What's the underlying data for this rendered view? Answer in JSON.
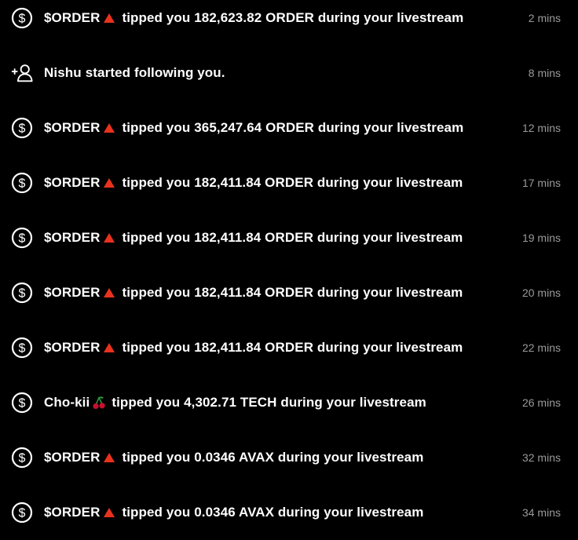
{
  "colors": {
    "background": "#000000",
    "text": "#ffffff",
    "timestamp": "#9a9a9a",
    "triangle_red": "#e8321e",
    "cherry_red": "#c8102e",
    "cherry_leaf": "#2e9e3a"
  },
  "notifications": [
    {
      "icon": "dollar-circle-icon",
      "user": "$ORDER",
      "emoji": "red-triangle-icon",
      "message": "tipped you 182,623.82 ORDER during your livestream",
      "time": "2 mins"
    },
    {
      "icon": "user-plus-icon",
      "user": "Nishu",
      "emoji": "",
      "message": "started following you.",
      "time": "8 mins"
    },
    {
      "icon": "dollar-circle-icon",
      "user": "$ORDER",
      "emoji": "red-triangle-icon",
      "message": "tipped you 365,247.64 ORDER during your livestream",
      "time": "12 mins"
    },
    {
      "icon": "dollar-circle-icon",
      "user": "$ORDER",
      "emoji": "red-triangle-icon",
      "message": "tipped you 182,411.84 ORDER during your livestream",
      "time": "17 mins"
    },
    {
      "icon": "dollar-circle-icon",
      "user": "$ORDER",
      "emoji": "red-triangle-icon",
      "message": "tipped you 182,411.84 ORDER during your livestream",
      "time": "19 mins"
    },
    {
      "icon": "dollar-circle-icon",
      "user": "$ORDER",
      "emoji": "red-triangle-icon",
      "message": "tipped you 182,411.84 ORDER during your livestream",
      "time": "20 mins"
    },
    {
      "icon": "dollar-circle-icon",
      "user": "$ORDER",
      "emoji": "red-triangle-icon",
      "message": "tipped you 182,411.84 ORDER during your livestream",
      "time": "22 mins"
    },
    {
      "icon": "dollar-circle-icon",
      "user": "Cho-kii",
      "emoji": "cherry-icon",
      "message": "tipped you 4,302.71 TECH during your livestream",
      "time": "26 mins"
    },
    {
      "icon": "dollar-circle-icon",
      "user": "$ORDER",
      "emoji": "red-triangle-icon",
      "message": "tipped you 0.0346 AVAX during your livestream",
      "time": "32 mins"
    },
    {
      "icon": "dollar-circle-icon",
      "user": "$ORDER",
      "emoji": "red-triangle-icon",
      "message": "tipped you 0.0346 AVAX during your livestream",
      "time": "34 mins"
    }
  ]
}
